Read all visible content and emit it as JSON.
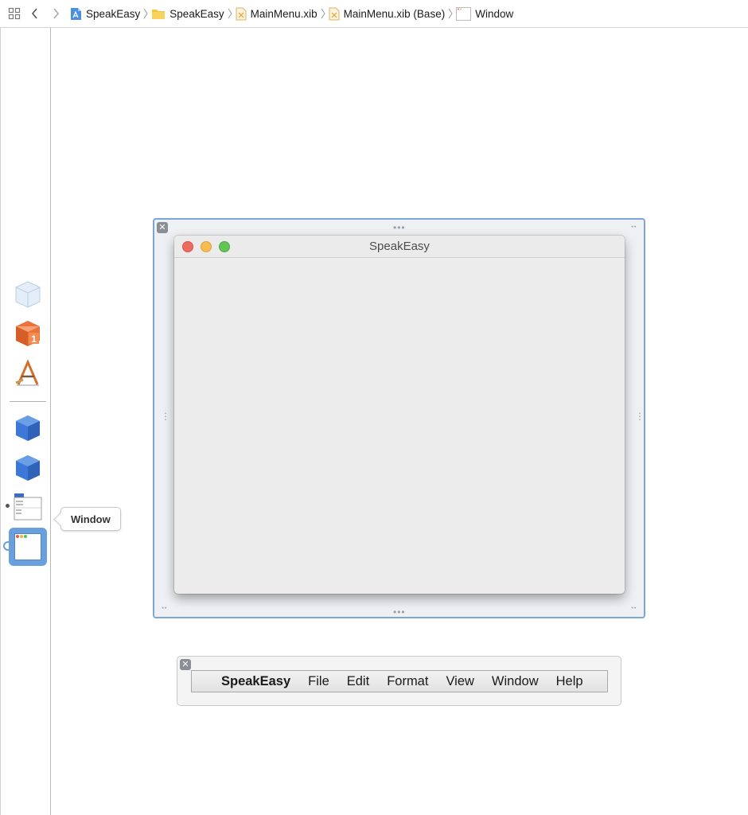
{
  "jumpbar": {
    "crumbs": [
      {
        "label": "SpeakEasy",
        "icon": "project-icon"
      },
      {
        "label": "SpeakEasy",
        "icon": "folder-icon"
      },
      {
        "label": "MainMenu.xib",
        "icon": "xib-file-icon"
      },
      {
        "label": "MainMenu.xib (Base)",
        "icon": "xib-file-icon"
      },
      {
        "label": "Window",
        "icon": "window-icon"
      }
    ]
  },
  "dock": {
    "items": [
      "placeholder-cube-icon",
      "first-responder-icon",
      "application-icon",
      "object-cube-icon",
      "object-cube-icon",
      "main-menu-icon",
      "window-icon"
    ],
    "selected": "Window",
    "tooltip": "Window"
  },
  "window": {
    "title": "SpeakEasy",
    "traffic_colors": [
      "#ee6a5f",
      "#f5bd4f",
      "#61c554"
    ]
  },
  "menu": {
    "app_name": "SpeakEasy",
    "items": [
      "File",
      "Edit",
      "Format",
      "View",
      "Window",
      "Help"
    ]
  },
  "colors": {
    "selection": "#6a9fde",
    "scene_border": "#7aa6d8"
  }
}
